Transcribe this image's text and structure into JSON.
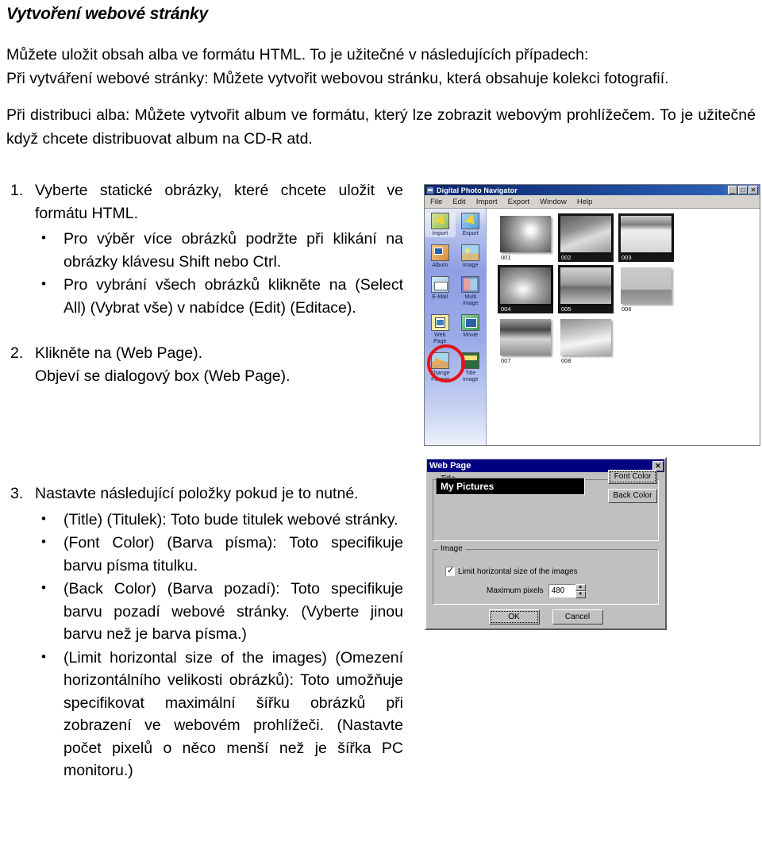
{
  "document": {
    "title": "Vytvoření webové stránky",
    "intro_lines": [
      "Můžete uložit obsah alba ve formátu HTML. To je užitečné v následujících případech:",
      "Při vytváření webové stránky: Můžete vytvořit webovou stránku, která obsahuje kolekci fotografií.",
      "Při distribuci alba: Můžete vytvořit album ve formátu, který lze zobrazit webovým prohlížečem. To je užitečné když chcete distribuovat album na CD-R atd."
    ],
    "steps": [
      {
        "number": "1.",
        "text": "Vyberte statické obrázky, které chcete uložit ve formátu HTML.",
        "bullets": [
          "Pro výběr více obrázků podržte při klikání na obrázky klávesu Shift nebo Ctrl.",
          "Pro vybrání všech obrázků klikněte na (Select All) (Vybrat vše) v nabídce (Edit) (Editace)."
        ]
      },
      {
        "number": "2.",
        "text": "Klikněte na (Web Page).",
        "text2": "Objeví se dialogový box (Web Page).",
        "bullets": []
      },
      {
        "number": "3.",
        "text": "Nastavte následující položky pokud je to nutné.",
        "bullets": [
          "(Title) (Titulek): Toto bude titulek webové stránky.",
          "(Font Color) (Barva písma): Toto specifikuje barvu písma titulku.",
          "(Back Color) (Barva pozadí): Toto specifikuje barvu pozadí webové stránky. (Vyberte jinou barvu než je barva písma.)",
          "(Limit horizontal size of the images) (Omezení horizontálního velikosti obrázků): Toto umožňuje specifikovat maximální šířku obrázků při zobrazení ve webovém prohlížeči. (Nastavte počet pixelů o něco menší než je šířka PC monitoru.)"
        ]
      }
    ],
    "bullet_glyph": "•"
  },
  "navigator_window": {
    "title": "Digital Photo Navigator",
    "window_buttons": [
      "_",
      "□",
      "✕"
    ],
    "menu": [
      "File",
      "Edit",
      "Import",
      "Export",
      "Window",
      "Help"
    ],
    "sidebar_items": [
      {
        "label_line1": "Import",
        "label_line2": "",
        "icon": "import-icon",
        "selected": true
      },
      {
        "label_line1": "Export",
        "label_line2": "",
        "icon": "export-icon",
        "selected": false
      },
      {
        "label_line1": "Album",
        "label_line2": "",
        "icon": "album-icon",
        "selected": false
      },
      {
        "label_line1": "Image",
        "label_line2": "",
        "icon": "image-icon",
        "selected": false
      },
      {
        "label_line1": "E-Mail",
        "label_line2": "",
        "icon": "email-icon",
        "selected": false
      },
      {
        "label_line1": "Multi",
        "label_line2": "Image",
        "icon": "multi-image-icon",
        "selected": false
      },
      {
        "label_line1": "Web",
        "label_line2": "Page",
        "icon": "web-page-icon",
        "selected": false
      },
      {
        "label_line1": "Movie",
        "label_line2": "",
        "icon": "movie-icon",
        "selected": false
      },
      {
        "label_line1": "Change",
        "label_line2": "Format",
        "icon": "change-format-icon",
        "selected": false
      },
      {
        "label_line1": "Title",
        "label_line2": "Image",
        "icon": "title-image-icon",
        "selected": false
      }
    ],
    "highlight_color": "#e2131a",
    "thumbnails": [
      {
        "label": "001",
        "selected": false
      },
      {
        "label": "002",
        "selected": true
      },
      {
        "label": "003",
        "selected": true
      },
      {
        "label": "004",
        "selected": true
      },
      {
        "label": "005",
        "selected": true
      },
      {
        "label": "006",
        "selected": false
      },
      {
        "label": "007",
        "selected": false
      },
      {
        "label": "008",
        "selected": false
      }
    ]
  },
  "web_page_dialog": {
    "title": "Web Page",
    "close_label": "✕",
    "title_group_legend": "Title",
    "title_value": "My Pictures",
    "font_color_button": "Font Color",
    "back_color_button": "Back Color",
    "image_group_legend": "Image",
    "limit_checkbox_label": "Limit horizontal size of the images",
    "max_pixels_label": "Maximum pixels",
    "max_pixels_value": "480",
    "spin_up": "▲",
    "spin_down": "▼",
    "ok_button": "OK",
    "cancel_button": "Cancel",
    "titlebar_color": "#000080"
  }
}
